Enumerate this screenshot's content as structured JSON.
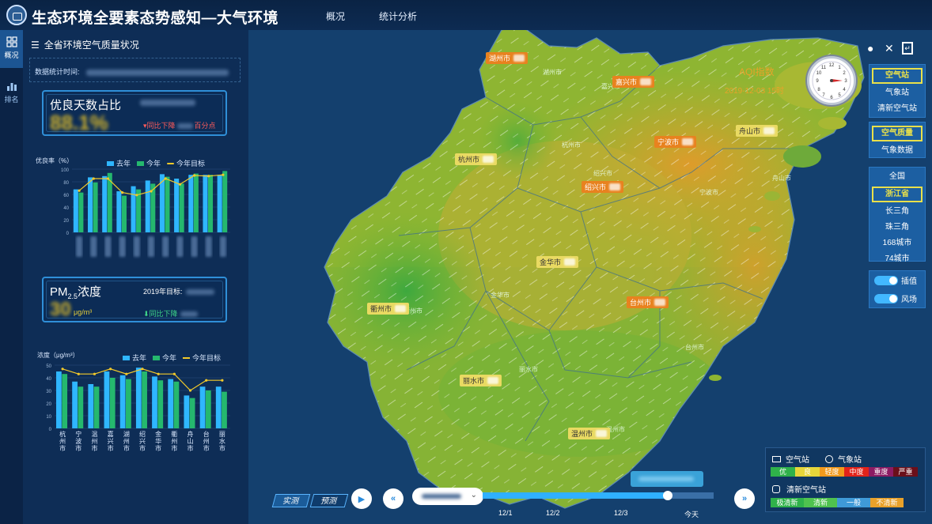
{
  "header": {
    "title": "生态环境全要素态势感知—大气环境",
    "nav": [
      "概况",
      "统计分析"
    ]
  },
  "rail": {
    "items": [
      {
        "label": "概况"
      },
      {
        "label": "排名"
      }
    ]
  },
  "panel": {
    "title": "全省环境空气质量状况",
    "time_label": "数据统计时间:",
    "good_days": {
      "title": "优良天数占比",
      "value": "88.1%",
      "note": "同比下降",
      "note_suffix": "百分点"
    },
    "pm25": {
      "title_main": "PM",
      "title_sub": "2.5",
      "title_rest": "浓度",
      "target_label": "2019年目标:",
      "value": "30",
      "unit": "μg/m³",
      "note": "同比下降"
    }
  },
  "chart_data": [
    {
      "type": "bar",
      "ylabel": "优良率（%）",
      "ylim": [
        0,
        100
      ],
      "categories": [
        "",
        "",
        "",
        "",
        "",
        "",
        "",
        "",
        "",
        "",
        ""
      ],
      "series": [
        {
          "name": "去年",
          "values": [
            68,
            87,
            89,
            65,
            73,
            82,
            92,
            85,
            91,
            91,
            91
          ]
        },
        {
          "name": "今年",
          "values": [
            63,
            79,
            94,
            58,
            68,
            77,
            88,
            77,
            93,
            91,
            97
          ]
        },
        {
          "name": "今年目标",
          "type": "line",
          "values": [
            66,
            85,
            85,
            63,
            59,
            65,
            85,
            76,
            90,
            89,
            91
          ]
        }
      ],
      "legend": "top-right"
    },
    {
      "type": "bar",
      "ylabel": "浓度（μg/m³）",
      "ylim": [
        0,
        50
      ],
      "categories": [
        "杭州市",
        "宁波市",
        "温州市",
        "嘉兴市",
        "湖州市",
        "绍兴市",
        "金华市",
        "衢州市",
        "舟山市",
        "台州市",
        "丽水市"
      ],
      "series": [
        {
          "name": "去年",
          "values": [
            45,
            37,
            35,
            45,
            42,
            48,
            41,
            39,
            26,
            33,
            33
          ]
        },
        {
          "name": "今年",
          "values": [
            43,
            33,
            33,
            40,
            39,
            45,
            38,
            37,
            24,
            30,
            29
          ]
        },
        {
          "name": "今年目标",
          "type": "line",
          "values": [
            47,
            43,
            43,
            47,
            43,
            47,
            43,
            43,
            30,
            38,
            38
          ]
        }
      ],
      "legend": "top-right"
    }
  ],
  "map": {
    "aqi_title": "AQI指数",
    "aqi_date": "2019-12-03 15时",
    "cities": [
      {
        "name": "湖州市",
        "style": "orange"
      },
      {
        "name": "嘉兴市",
        "style": "orange"
      },
      {
        "name": "舟山市",
        "style": "yellow"
      },
      {
        "name": "宁波市",
        "style": "orange"
      },
      {
        "name": "杭州市",
        "style": "yellow"
      },
      {
        "name": "绍兴市",
        "style": "orange"
      },
      {
        "name": "金华市",
        "style": "yellow"
      },
      {
        "name": "衢州市",
        "style": "yellow"
      },
      {
        "name": "台州市",
        "style": "orange"
      },
      {
        "name": "丽水市",
        "style": "yellow"
      },
      {
        "name": "温州市",
        "style": "yellow"
      }
    ],
    "county_labels": [
      "湖州市",
      "嘉兴市",
      "杭州市",
      "绍兴市",
      "宁波市",
      "舟山市",
      "金华市",
      "衢州市",
      "丽水市",
      "台州市",
      "温州市"
    ]
  },
  "right": {
    "station_group": [
      "空气站",
      "气象站",
      "清新空气站"
    ],
    "data_group": [
      "空气质量",
      "气象数据"
    ],
    "region_group": [
      "全国",
      "浙江省",
      "长三角",
      "珠三角",
      "168城市",
      "74城市"
    ],
    "toggles": [
      "插值",
      "风场"
    ]
  },
  "legend": {
    "row1": [
      "空气站",
      "气象站"
    ],
    "levels": [
      {
        "label": "优",
        "color": "#2fb24a"
      },
      {
        "label": "良",
        "color": "#e7d63a"
      },
      {
        "label": "轻度",
        "color": "#f29a1c"
      },
      {
        "label": "中度",
        "color": "#e2231a"
      },
      {
        "label": "重度",
        "color": "#8c1b63"
      },
      {
        "label": "严重",
        "color": "#6b0f1a"
      }
    ],
    "fresh_title": "清新空气站",
    "fresh_levels": [
      {
        "label": "极清新",
        "color": "#2fb24a"
      },
      {
        "label": "清新",
        "color": "#4fc24f"
      },
      {
        "label": "一般",
        "color": "#3f9ad8"
      },
      {
        "label": "不清新",
        "color": "#e9a12a"
      }
    ]
  },
  "timeline": {
    "modes": [
      "实测",
      "预测"
    ],
    "ticks": [
      "12/1",
      "12/2",
      "12/3",
      "今天"
    ]
  }
}
